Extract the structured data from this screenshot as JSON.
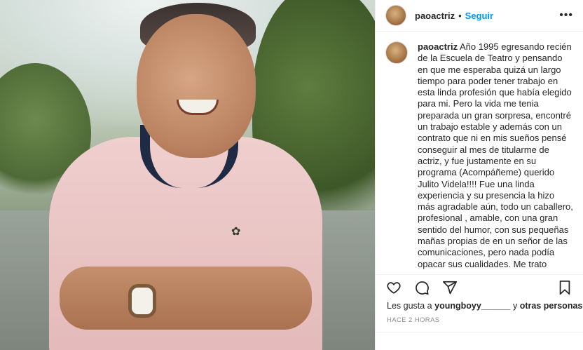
{
  "post": {
    "username": "paoactriz",
    "separator": "•",
    "follow_label": "Seguir",
    "more_label": "•••",
    "caption": {
      "username": "paoactriz",
      "text": "Año 1995 egresando recién de la Escuela de Teatro y pensando en que me esperaba quizá un largo tiempo para poder tener trabajo en esta linda profesión que había elegido para mi. Pero la vida me tenia preparada un gran sorpresa, encontré un trabajo estable y además con un contrato que ni en mis sueños pensé conseguir al mes de titularme de actriz, y fue justamente en su programa (Acompáñeme) querido Julito Videla!!!! Fue una linda experiencia y su presencia la hizo más agradable aún, todo un caballero, profesional , amable, con una gran sentido del humor, con sus pequeñas mañas propias de en un señor de las comunicaciones, pero nada podía opacar sus cualidades. Me trato"
    },
    "likes": {
      "prefix": "Les gusta a",
      "user": "youngboyy______",
      "conj": "y",
      "others": "otras personas"
    },
    "timestamp": "HACE 2 HORAS",
    "icons": {
      "like": "heart-icon",
      "comment": "comment-icon",
      "share": "send-icon",
      "save": "bookmark-icon",
      "logo": "✿"
    },
    "colors": {
      "accent": "#0095f6",
      "text": "#262626",
      "muted": "#8e8e8e"
    }
  }
}
